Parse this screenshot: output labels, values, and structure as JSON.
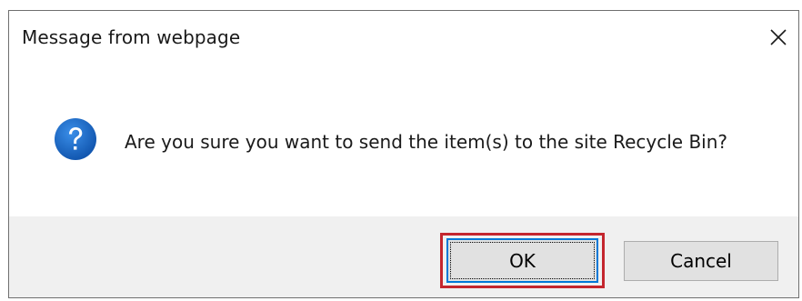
{
  "dialog": {
    "title": "Message from webpage",
    "close_icon": "close-icon",
    "message_icon": "question-icon",
    "message": "Are you sure you want to send the item(s) to the site Recycle Bin?",
    "buttons": {
      "ok_label": "OK",
      "cancel_label": "Cancel"
    }
  },
  "colors": {
    "icon_blue": "#1e6bc6",
    "focus_border": "#0078d7",
    "highlight_red": "#c4262e",
    "footer_bg": "#f0f0f0",
    "button_bg": "#e1e1e1"
  }
}
